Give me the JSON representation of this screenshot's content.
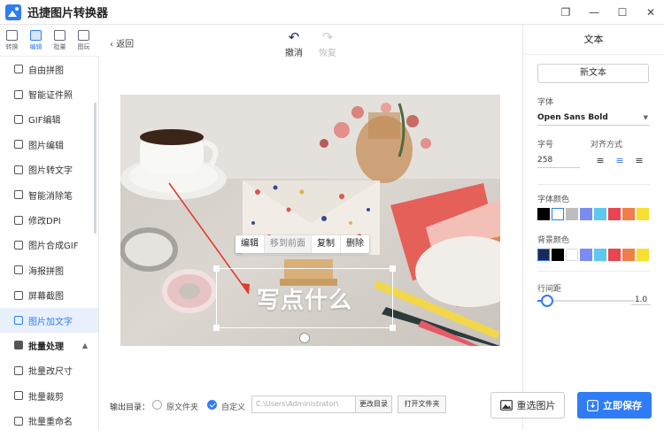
{
  "app": {
    "title": "迅捷图片转换器"
  },
  "window": {
    "restore": "❐",
    "minimize": "—",
    "maximize": "☐",
    "close": "✕"
  },
  "modes": [
    {
      "label": "转换",
      "icon": "convert-icon"
    },
    {
      "label": "编辑",
      "icon": "edit-icon"
    },
    {
      "label": "批量",
      "icon": "batch-icon"
    },
    {
      "label": "图玩",
      "icon": "gallery-icon"
    }
  ],
  "sidebar": {
    "items": [
      {
        "label": "自由拼图",
        "icon": "collage-icon"
      },
      {
        "label": "智能证件照",
        "icon": "id-photo-icon"
      },
      {
        "label": "GIF编辑",
        "icon": "gif-icon"
      },
      {
        "label": "图片编辑",
        "icon": "image-edit-icon"
      },
      {
        "label": "图片转文字",
        "icon": "ocr-icon"
      },
      {
        "label": "智能消除笔",
        "icon": "eraser-icon"
      },
      {
        "label": "修改DPI",
        "icon": "dpi-icon"
      },
      {
        "label": "图片合成GIF",
        "icon": "gif-compose-icon"
      },
      {
        "label": "海报拼图",
        "icon": "poster-icon"
      },
      {
        "label": "屏幕截图",
        "icon": "screenshot-icon"
      },
      {
        "label": "图片加文字",
        "icon": "add-text-icon"
      }
    ],
    "group": {
      "label": "批量处理",
      "chevron": "▲"
    },
    "group_items": [
      {
        "label": "批量改尺寸",
        "icon": "resize-icon"
      },
      {
        "label": "批量裁剪",
        "icon": "crop-icon"
      },
      {
        "label": "批量重命名",
        "icon": "rename-icon"
      }
    ]
  },
  "toolbar": {
    "back": "返回",
    "back_glyph": "‹",
    "undo": "撤消",
    "redo": "恢复",
    "undo_glyph": "↶",
    "redo_glyph": "↷"
  },
  "context_menu": {
    "edit": "编辑",
    "bring_front": "移到前面",
    "copy": "复制",
    "delete": "删除"
  },
  "canvas": {
    "text": "写点什么"
  },
  "right_panel": {
    "title": "文本",
    "new_text": "新文本",
    "font_label": "字体",
    "font_value": "Open Sans Bold",
    "size_label": "字号",
    "size_value": "258",
    "align_label": "对齐方式",
    "align_glyphs": [
      "≡",
      "≡",
      "≡"
    ],
    "font_color_label": "字体颜色",
    "font_colors": [
      "#000000",
      "#ffffff",
      "#bdbdbd",
      "#7a8cf0",
      "#5ec8f0",
      "#e8454e",
      "#f07e4a",
      "#f7e12e"
    ],
    "bg_color_label": "背景颜色",
    "bg_colors": [
      "#1d2a55",
      "#000000",
      "#ffffff",
      "#7a8cf0",
      "#5ec8f0",
      "#e8454e",
      "#f07e4a",
      "#f7e12e"
    ],
    "line_spacing_label": "行间距",
    "line_spacing_value": "1.0",
    "line_spacing_fraction": 0.1
  },
  "bottom": {
    "output_label": "输出目录：",
    "option_original": "原文件夹",
    "option_custom": "自定义",
    "path": "C:\\Users\\Administrator\\",
    "change_dir": "更改目录",
    "open_folder": "打开文件夹",
    "reselect": "重选图片",
    "save": "立即保存"
  }
}
